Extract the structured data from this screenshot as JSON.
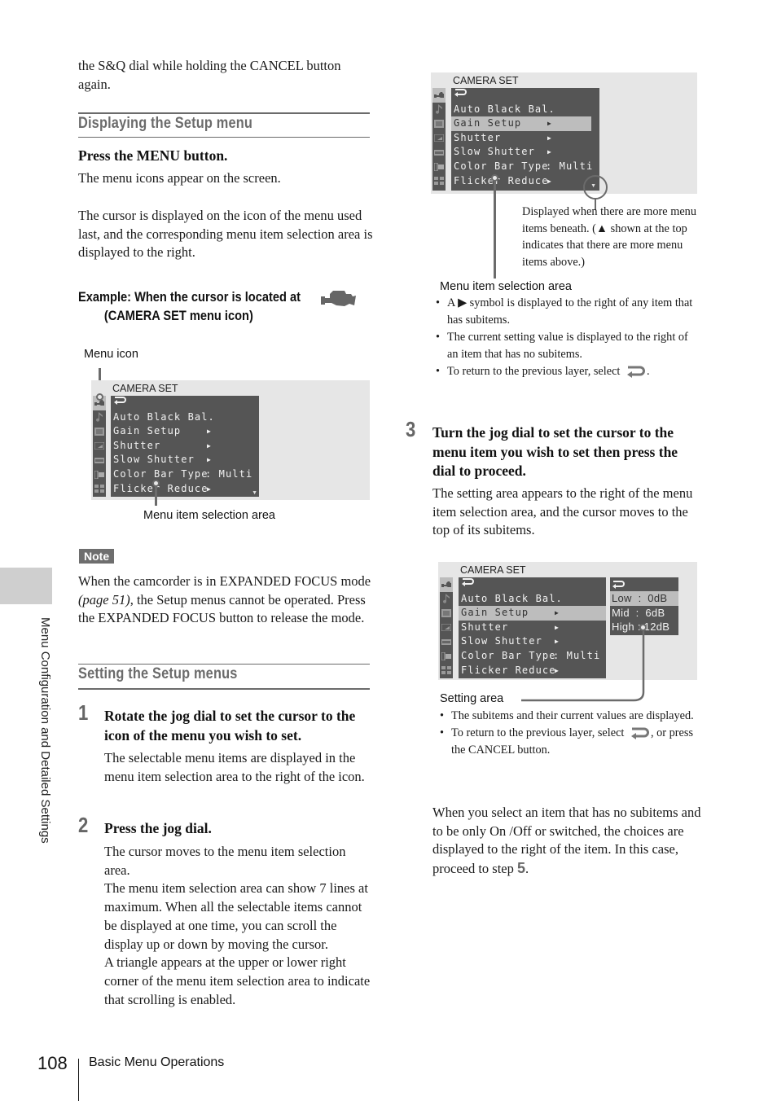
{
  "page": {
    "number": "108",
    "footer_section": "Basic Menu Operations",
    "side_tab_label": "Menu Configuration and Detailed Settings"
  },
  "left": {
    "intro_text": "the S&Q dial while holding the CANCEL button again.",
    "section1": {
      "heading": "Displaying the Setup menu",
      "instruction": "Press the MENU button.",
      "para1": "The menu icons appear on the screen.",
      "para2": "The cursor is displayed on the icon of the menu used last, and the corresponding menu item selection area is displayed to the right.",
      "example_line1": "Example: When the cursor is located at",
      "example_line2": "(CAMERA SET menu icon)",
      "example_icon": "camera-set-icon"
    },
    "figure1": {
      "callout_top": "Menu icon",
      "callout_bottom": "Menu item selection area",
      "screen_title": "CAMERA SET"
    },
    "note": {
      "badge": "Note",
      "text_before": "When the camcorder is in EXPANDED FOCUS mode ",
      "page_ref": "(page 51)",
      "text_after": ", the Setup menus cannot be operated. Press the EXPANDED FOCUS button to release the mode."
    },
    "section2": {
      "heading": "Setting the Setup menus",
      "steps": [
        {
          "number": "1",
          "title": "Rotate the jog dial to set the cursor to the icon of the menu you wish to set.",
          "body": "The selectable menu items are displayed in the menu item selection area to the right of the icon."
        },
        {
          "number": "2",
          "title": "Press the jog dial.",
          "body1": "The cursor moves to the menu item selection area.",
          "body2": "The menu item selection area can show 7 lines at maximum. When all the selectable items cannot be displayed at one time, you can scroll the display up or down by moving the cursor.",
          "body3": "A triangle appears at the upper or lower right corner of the menu item selection area to indicate that scrolling is enabled."
        }
      ]
    }
  },
  "menu": {
    "title": "CAMERA SET",
    "icons": [
      "camera-icon",
      "audio-note-icon",
      "film-frame-icon",
      "display-icon",
      "timecode-icon",
      "video-out-icon",
      "grid-icon"
    ],
    "return_label": "return-icon",
    "items": [
      {
        "label": "Auto Black Bal.",
        "value": "",
        "has_subitems": false
      },
      {
        "label": "Gain Setup",
        "value": "",
        "has_subitems": true
      },
      {
        "label": "Shutter",
        "value": "",
        "has_subitems": true
      },
      {
        "label": "Slow Shutter",
        "value": "",
        "has_subitems": true
      },
      {
        "label": "Color Bar Type",
        "value": ": Multi",
        "has_subitems": false
      },
      {
        "label": "Flicker Reduce",
        "value": "",
        "has_subitems": true
      }
    ],
    "subitems": [
      {
        "label": "Low  :  0dB"
      },
      {
        "label": "Mid  :  6dB"
      },
      {
        "label": "High : 12dB"
      }
    ]
  },
  "right": {
    "figure2": {
      "scroll_callout": "Displayed when there are more menu items beneath. (▲ shown at the top indicates that there are more menu items above.)",
      "area_label": "Menu item selection area",
      "bullets": [
        "A ▶ symbol is displayed to the right of any item that has subitems.",
        "The current setting value is displayed to the right of an item that has no subitems.",
        "To return to the previous layer, select"
      ]
    },
    "step3": {
      "number": "3",
      "title": "Turn the jog dial to set the cursor to the menu item you wish to set then press the dial to proceed.",
      "body": "The setting area appears to the right of the menu item selection area, and the cursor moves to the top of its subitems."
    },
    "figure3": {
      "area_label": "Setting area",
      "bullet1": "The subitems and their current values are displayed.",
      "bullet2_before": "To return to the previous layer, select",
      "bullet2_after": ", or press the CANCEL button."
    },
    "closing": {
      "text": "When you select an item that has no subitems and to be only On /Off or switched, the choices are displayed to the right of the item. In this case, proceed to step ",
      "step_ref": "5",
      "end": "."
    }
  }
}
